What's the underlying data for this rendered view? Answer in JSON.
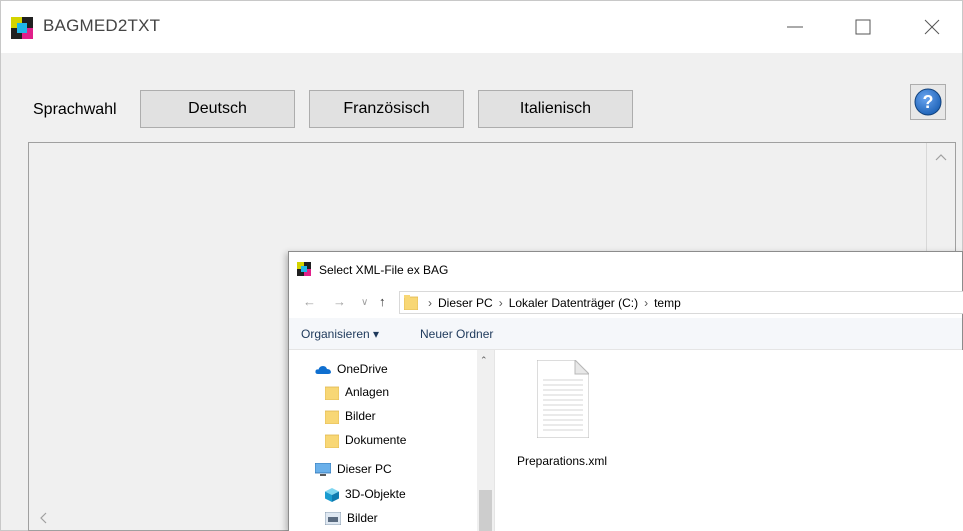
{
  "window": {
    "title": "BAGMED2TXT",
    "controls": {
      "minimize": "minimize-icon",
      "maximize": "maximize-icon",
      "close": "close-icon"
    }
  },
  "language": {
    "label": "Sprachwahl",
    "buttons": [
      "Deutsch",
      "Französisch",
      "Italienisch"
    ],
    "help_icon": "help-icon"
  },
  "dialog": {
    "title": "Select XML-File ex BAG",
    "breadcrumbs": [
      "Dieser PC",
      "Lokaler Datenträger (C:)",
      "temp"
    ],
    "toolbar": {
      "organize": "Organisieren ▾",
      "new_folder": "Neuer Ordner"
    },
    "nav_items": [
      "OneDrive",
      "Anlagen",
      "Bilder",
      "Dokumente",
      "Dieser PC",
      "3D-Objekte",
      "Bilder"
    ],
    "files": [
      {
        "name": "Preparations.xml",
        "icon": "document-icon"
      }
    ]
  },
  "colors": {
    "help_blue": "#1a5fb4",
    "folder_yellow": "#f8d775",
    "onedrive_blue": "#0f6fd0",
    "link_text": "#1e395b"
  }
}
